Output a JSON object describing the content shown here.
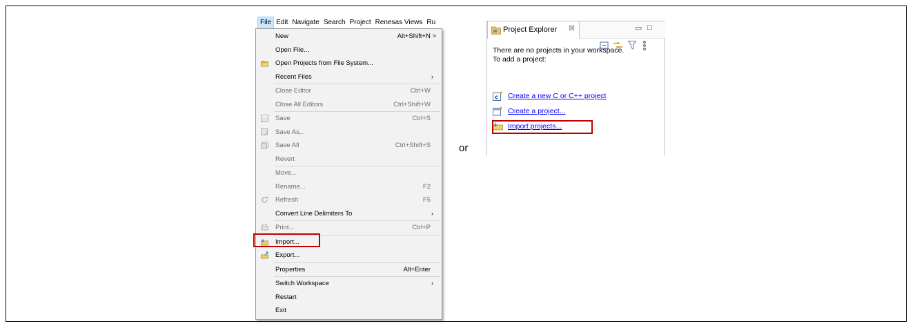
{
  "menubar": {
    "items": [
      "File",
      "Edit",
      "Navigate",
      "Search",
      "Project",
      "Renesas Views",
      "Ru"
    ]
  },
  "file_menu": {
    "items": [
      {
        "label": "New",
        "shortcut": "Alt+Shift+N >",
        "enabled": true
      },
      {
        "label": "Open File...",
        "shortcut": "",
        "enabled": true
      },
      {
        "label": "Open Projects from File System...",
        "shortcut": "",
        "enabled": true,
        "icon": "folder-icon"
      },
      {
        "label": "Recent Files",
        "shortcut": "",
        "enabled": true,
        "submenu": true
      },
      {
        "label": "Close Editor",
        "shortcut": "Ctrl+W",
        "enabled": false
      },
      {
        "label": "Close All Editors",
        "shortcut": "Ctrl+Shift+W",
        "enabled": false
      },
      {
        "label": "Save",
        "shortcut": "Ctrl+S",
        "enabled": false,
        "icon": "save-icon"
      },
      {
        "label": "Save As...",
        "shortcut": "",
        "enabled": false,
        "icon": "save-as-icon"
      },
      {
        "label": "Save All",
        "shortcut": "Ctrl+Shift+S",
        "enabled": false,
        "icon": "save-all-icon"
      },
      {
        "label": "Revert",
        "shortcut": "",
        "enabled": false
      },
      {
        "label": "Move...",
        "shortcut": "",
        "enabled": false
      },
      {
        "label": "Rename...",
        "shortcut": "F2",
        "enabled": false
      },
      {
        "label": "Refresh",
        "shortcut": "F5",
        "enabled": false,
        "icon": "refresh-icon"
      },
      {
        "label": "Convert Line Delimiters To",
        "shortcut": "",
        "enabled": true,
        "submenu": true
      },
      {
        "label": "Print...",
        "shortcut": "Ctrl+P",
        "enabled": false,
        "icon": "print-icon"
      },
      {
        "label": "Import...",
        "shortcut": "",
        "enabled": true,
        "icon": "import-icon"
      },
      {
        "label": "Export...",
        "shortcut": "",
        "enabled": true,
        "icon": "export-icon"
      },
      {
        "label": "Properties",
        "shortcut": "Alt+Enter",
        "enabled": true
      },
      {
        "label": "Switch Workspace",
        "shortcut": "",
        "enabled": true,
        "submenu": true
      },
      {
        "label": "Restart",
        "shortcut": "",
        "enabled": true
      },
      {
        "label": "Exit",
        "shortcut": "",
        "enabled": true
      }
    ]
  },
  "separator_text": "or",
  "project_explorer": {
    "tab_title": "Project Explorer",
    "close_glyph": "☒",
    "minimize_glyph": "▭",
    "maximize_glyph": "□",
    "message_line1": "There are no projects in your workspace.",
    "message_line2": "To add a project:",
    "links": [
      {
        "label": "Create a new C or C++ project",
        "icon": "new-c-project-icon"
      },
      {
        "label": "Create a project...",
        "icon": "new-project-icon"
      },
      {
        "label": "Import projects...",
        "icon": "import-icon"
      }
    ]
  },
  "colors": {
    "highlight_border": "#c00000",
    "link": "#0000ee",
    "menu_background": "#f2f2f2"
  }
}
